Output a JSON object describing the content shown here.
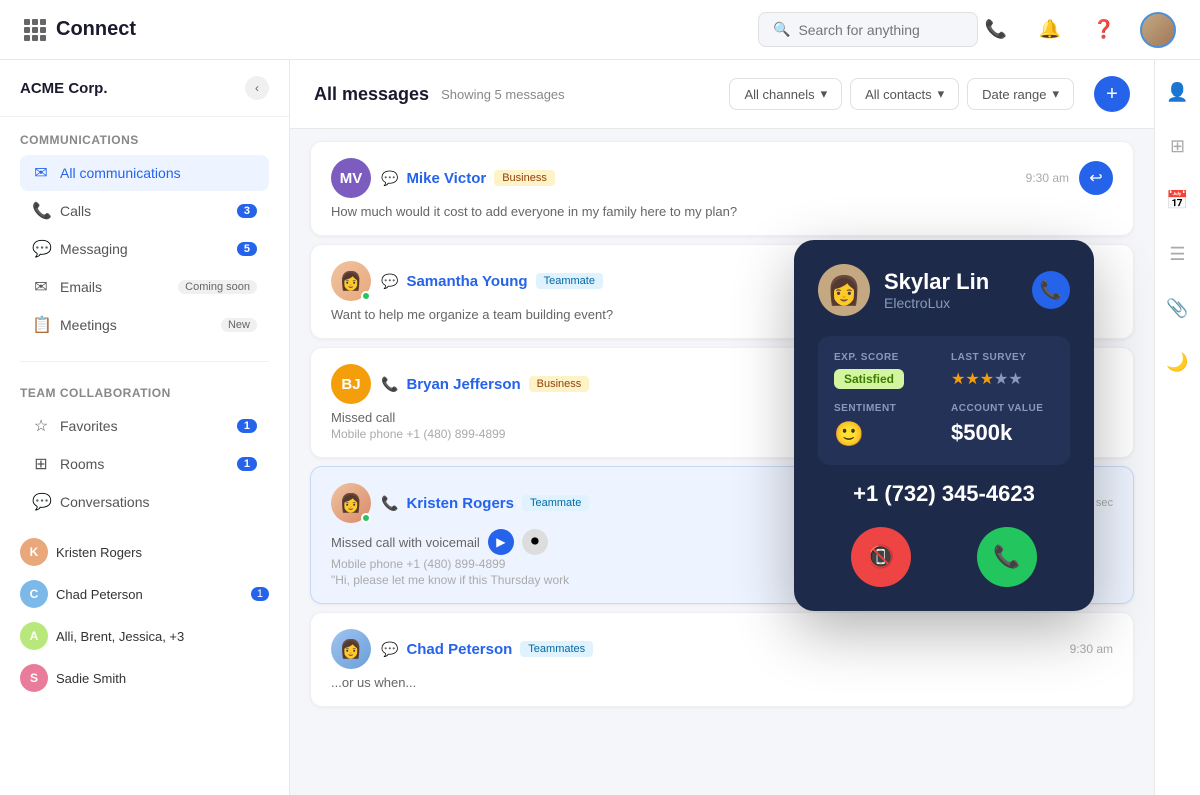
{
  "app": {
    "title": "Connect",
    "search_placeholder": "Search for anything"
  },
  "sidebar": {
    "company": "ACME Corp.",
    "communications_title": "Communications",
    "items": [
      {
        "id": "all-communications",
        "label": "All communications",
        "icon": "✉",
        "active": true,
        "badge": null
      },
      {
        "id": "calls",
        "label": "Calls",
        "icon": "📞",
        "active": false,
        "badge": "3"
      },
      {
        "id": "messaging",
        "label": "Messaging",
        "icon": "💬",
        "active": false,
        "badge": "5"
      },
      {
        "id": "emails",
        "label": "Emails",
        "icon": "✉",
        "active": false,
        "badge": "Coming soon"
      },
      {
        "id": "meetings",
        "label": "Meetings",
        "icon": "📋",
        "active": false,
        "badge": "New"
      }
    ],
    "team_title": "Team collaboration",
    "team_items": [
      {
        "id": "favorites",
        "label": "Favorites",
        "icon": "☆",
        "badge": "1"
      },
      {
        "id": "rooms",
        "label": "Rooms",
        "icon": "⊞",
        "badge": "1"
      },
      {
        "id": "conversations",
        "label": "Conversations",
        "icon": "💬",
        "badge": null
      }
    ],
    "conversations": [
      {
        "id": "kristen-rogers",
        "name": "Kristen Rogers",
        "color": "#e8a87c",
        "badge": null
      },
      {
        "id": "chad-peterson",
        "name": "Chad Peterson",
        "color": "#7cb9e8",
        "badge": "1"
      },
      {
        "id": "group-chat",
        "name": "Alli, Brent, Jessica, +3",
        "color": "#b8e87c",
        "badge": null
      },
      {
        "id": "sadie-smith",
        "name": "Sadie Smith",
        "color": "#e87c9a",
        "badge": null
      }
    ]
  },
  "content": {
    "title": "All messages",
    "showing_text": "Showing 5 messages",
    "filters": [
      "All channels",
      "All contacts",
      "Date range"
    ],
    "messages": [
      {
        "id": "mike-victor",
        "name": "Mike Victor",
        "tag": "Business",
        "tag_type": "business",
        "avatar_initials": "MV",
        "avatar_color": "#7c5cbf",
        "channel": "chat",
        "time": "9:30 am",
        "body": "How much would it cost to add everyone in my family here to my plan?",
        "has_reply": true,
        "highlighted": false
      },
      {
        "id": "samantha-young",
        "name": "Samantha Young",
        "tag": "Teammate",
        "tag_type": "teammate",
        "avatar_img": true,
        "avatar_color": "#e8a87c",
        "channel": "chat",
        "time": "",
        "body": "Want to help me organize a team building event?",
        "has_online": true,
        "highlighted": false
      },
      {
        "id": "bryan-jefferson",
        "name": "Bryan Jefferson",
        "tag": "Business",
        "tag_type": "business",
        "avatar_initials": "BJ",
        "avatar_color": "#f59e0b",
        "channel": "phone",
        "time": "",
        "body": "Missed call",
        "sub": "Mobile phone +1 (480) 899-4899",
        "highlighted": false
      },
      {
        "id": "kristen-rogers",
        "name": "Kristen Rogers",
        "tag": "Teammate",
        "tag_type": "teammate",
        "avatar_img": true,
        "avatar_color": "#e8a87c",
        "channel": "phone",
        "time": "15 sec",
        "body": "Missed call with voicemail",
        "sub": "Mobile phone +1 (480) 899-4899",
        "quote": "\"Hi, please let me know if this Thursday work",
        "has_voicemail": true,
        "has_online": true,
        "highlighted": true
      },
      {
        "id": "chad-peterson",
        "name": "Chad Peterson",
        "tag": "Teammates",
        "tag_type": "teammates",
        "avatar_img": true,
        "avatar_color": "#7cb9e8",
        "channel": "chat",
        "time": "9:30 am",
        "body": "...or us when...",
        "highlighted": false
      }
    ]
  },
  "call_card": {
    "name": "Skylar Lin",
    "company": "ElectroLux",
    "exp_score_label": "EXP. SCORE",
    "last_survey_label": "LAST SURVEY",
    "sentiment_label": "SENTIMENT",
    "account_value_label": "ACCOUNT VALUE",
    "exp_score_value": "Satisfied",
    "stars_filled": 3,
    "stars_total": 5,
    "sentiment_emoji": "🙂",
    "account_value": "$500k",
    "phone": "+1 (732) 345-4623"
  },
  "right_icons": [
    "person",
    "grid",
    "calendar",
    "list",
    "clip",
    "moon"
  ]
}
